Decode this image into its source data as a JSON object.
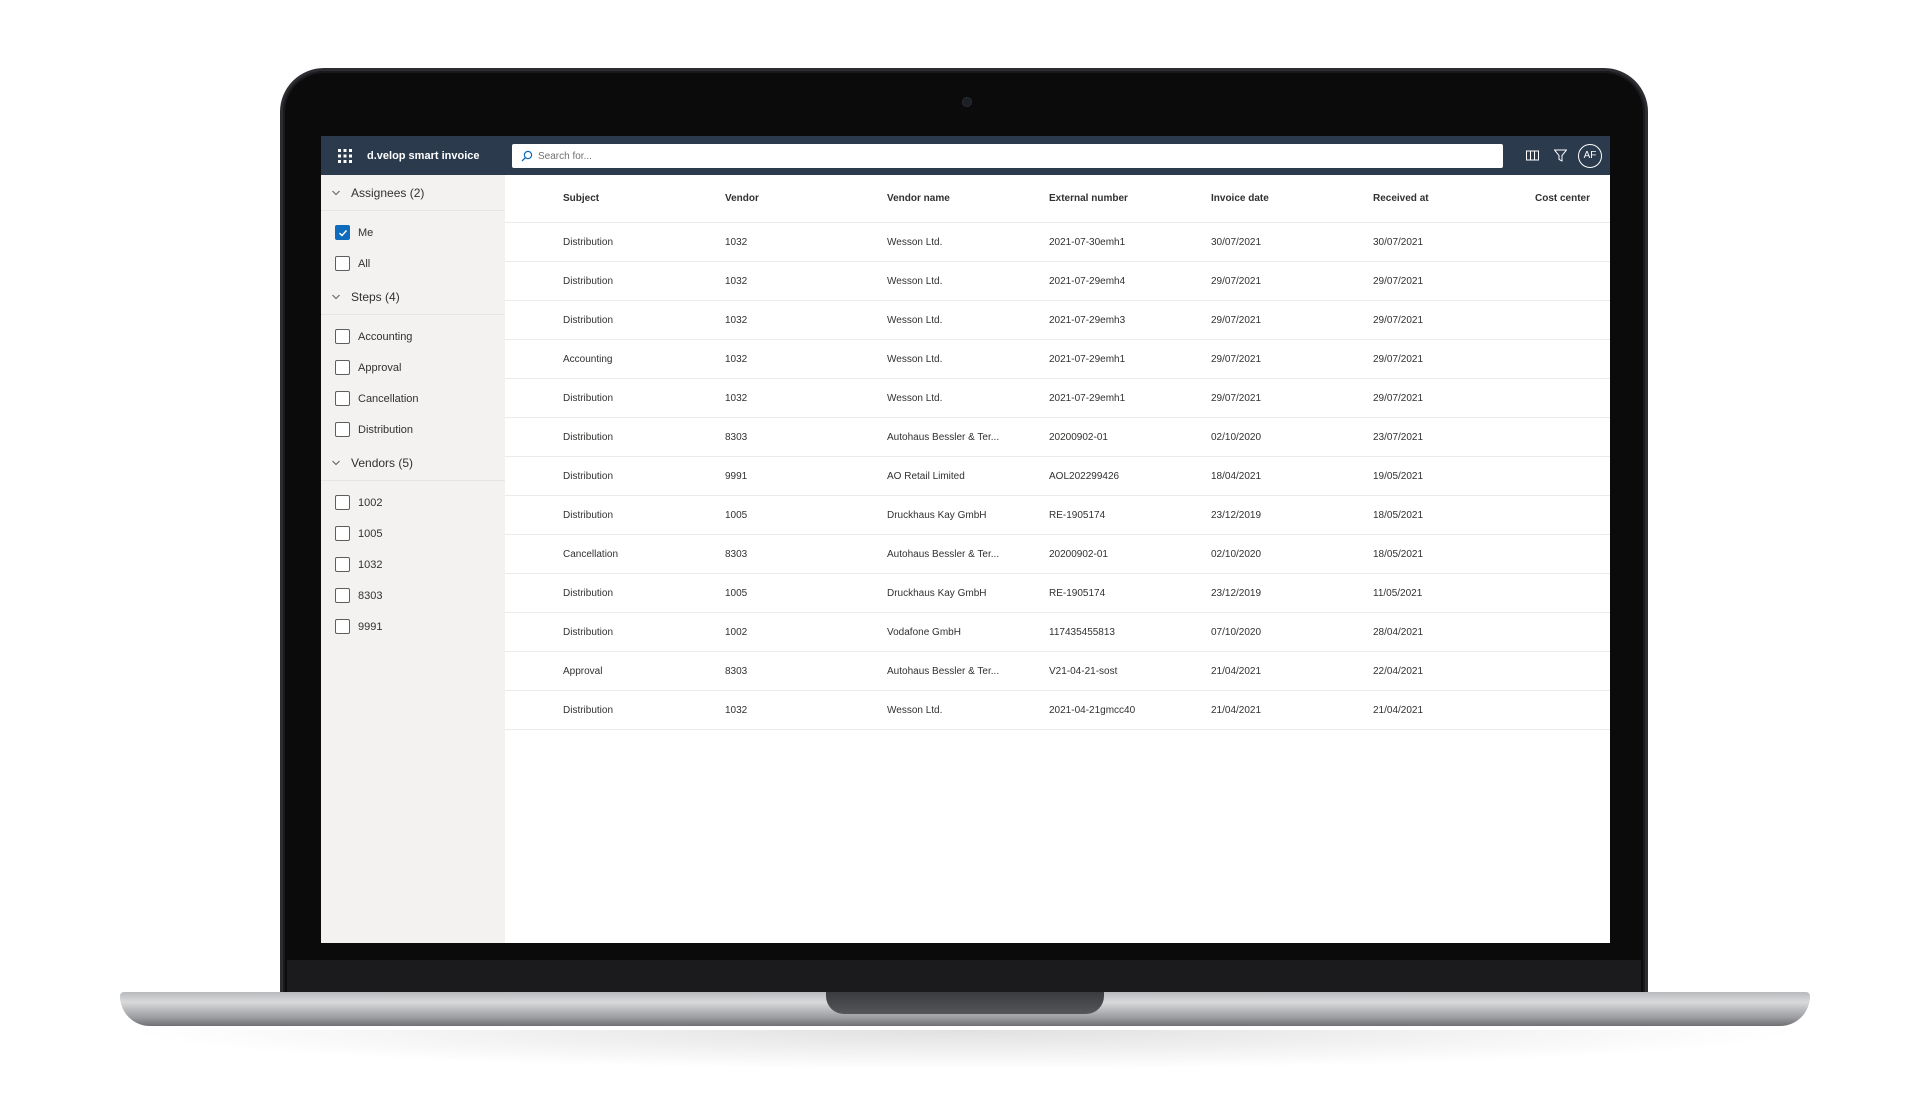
{
  "app": {
    "title": "d.velop smart invoice",
    "user_initials": "AF"
  },
  "search": {
    "placeholder": "Search for..."
  },
  "icons": {
    "waffle": "app-launcher-icon",
    "search": "search-icon",
    "columns": "columns-icon",
    "filter": "filter-icon",
    "chevron": "chevron-down-icon",
    "checkmark": "checkmark-icon"
  },
  "colors": {
    "topbar": "#2b3a4d",
    "sidebar": "#f3f2f1",
    "checkbox_checked": "#0f6cbd"
  },
  "sidebar": {
    "groups": [
      {
        "title": "Assignees (2)",
        "options": [
          {
            "label": "Me",
            "checked": true
          },
          {
            "label": "All",
            "checked": false
          }
        ]
      },
      {
        "title": "Steps (4)",
        "options": [
          {
            "label": "Accounting",
            "checked": false
          },
          {
            "label": "Approval",
            "checked": false
          },
          {
            "label": "Cancellation",
            "checked": false
          },
          {
            "label": "Distribution",
            "checked": false
          }
        ]
      },
      {
        "title": "Vendors (5)",
        "options": [
          {
            "label": "1002",
            "checked": false
          },
          {
            "label": "1005",
            "checked": false
          },
          {
            "label": "1032",
            "checked": false
          },
          {
            "label": "8303",
            "checked": false
          },
          {
            "label": "9991",
            "checked": false
          }
        ]
      }
    ]
  },
  "table": {
    "columns": [
      "Subject",
      "Vendor",
      "Vendor name",
      "External number",
      "Invoice date",
      "Received at",
      "Cost center"
    ],
    "rows": [
      [
        "Distribution",
        "1032",
        "Wesson Ltd.",
        "2021-07-30emh1",
        "30/07/2021",
        "30/07/2021",
        ""
      ],
      [
        "Distribution",
        "1032",
        "Wesson Ltd.",
        "2021-07-29emh4",
        "29/07/2021",
        "29/07/2021",
        ""
      ],
      [
        "Distribution",
        "1032",
        "Wesson Ltd.",
        "2021-07-29emh3",
        "29/07/2021",
        "29/07/2021",
        ""
      ],
      [
        "Accounting",
        "1032",
        "Wesson Ltd.",
        "2021-07-29emh1",
        "29/07/2021",
        "29/07/2021",
        ""
      ],
      [
        "Distribution",
        "1032",
        "Wesson Ltd.",
        "2021-07-29emh1",
        "29/07/2021",
        "29/07/2021",
        ""
      ],
      [
        "Distribution",
        "8303",
        "Autohaus Bessler & Ter...",
        "20200902-01",
        "02/10/2020",
        "23/07/2021",
        ""
      ],
      [
        "Distribution",
        "9991",
        "AO Retail Limited",
        "AOL202299426",
        "18/04/2021",
        "19/05/2021",
        ""
      ],
      [
        "Distribution",
        "1005",
        "Druckhaus Kay GmbH",
        "RE-1905174",
        "23/12/2019",
        "18/05/2021",
        ""
      ],
      [
        "Cancellation",
        "8303",
        "Autohaus Bessler & Ter...",
        "20200902-01",
        "02/10/2020",
        "18/05/2021",
        ""
      ],
      [
        "Distribution",
        "1005",
        "Druckhaus Kay GmbH",
        "RE-1905174",
        "23/12/2019",
        "11/05/2021",
        ""
      ],
      [
        "Distribution",
        "1002",
        "Vodafone GmbH",
        "117435455813",
        "07/10/2020",
        "28/04/2021",
        ""
      ],
      [
        "Approval",
        "8303",
        "Autohaus Bessler & Ter...",
        "V21-04-21-sost",
        "21/04/2021",
        "22/04/2021",
        ""
      ],
      [
        "Distribution",
        "1032",
        "Wesson Ltd.",
        "2021-04-21gmcc40",
        "21/04/2021",
        "21/04/2021",
        ""
      ]
    ]
  }
}
